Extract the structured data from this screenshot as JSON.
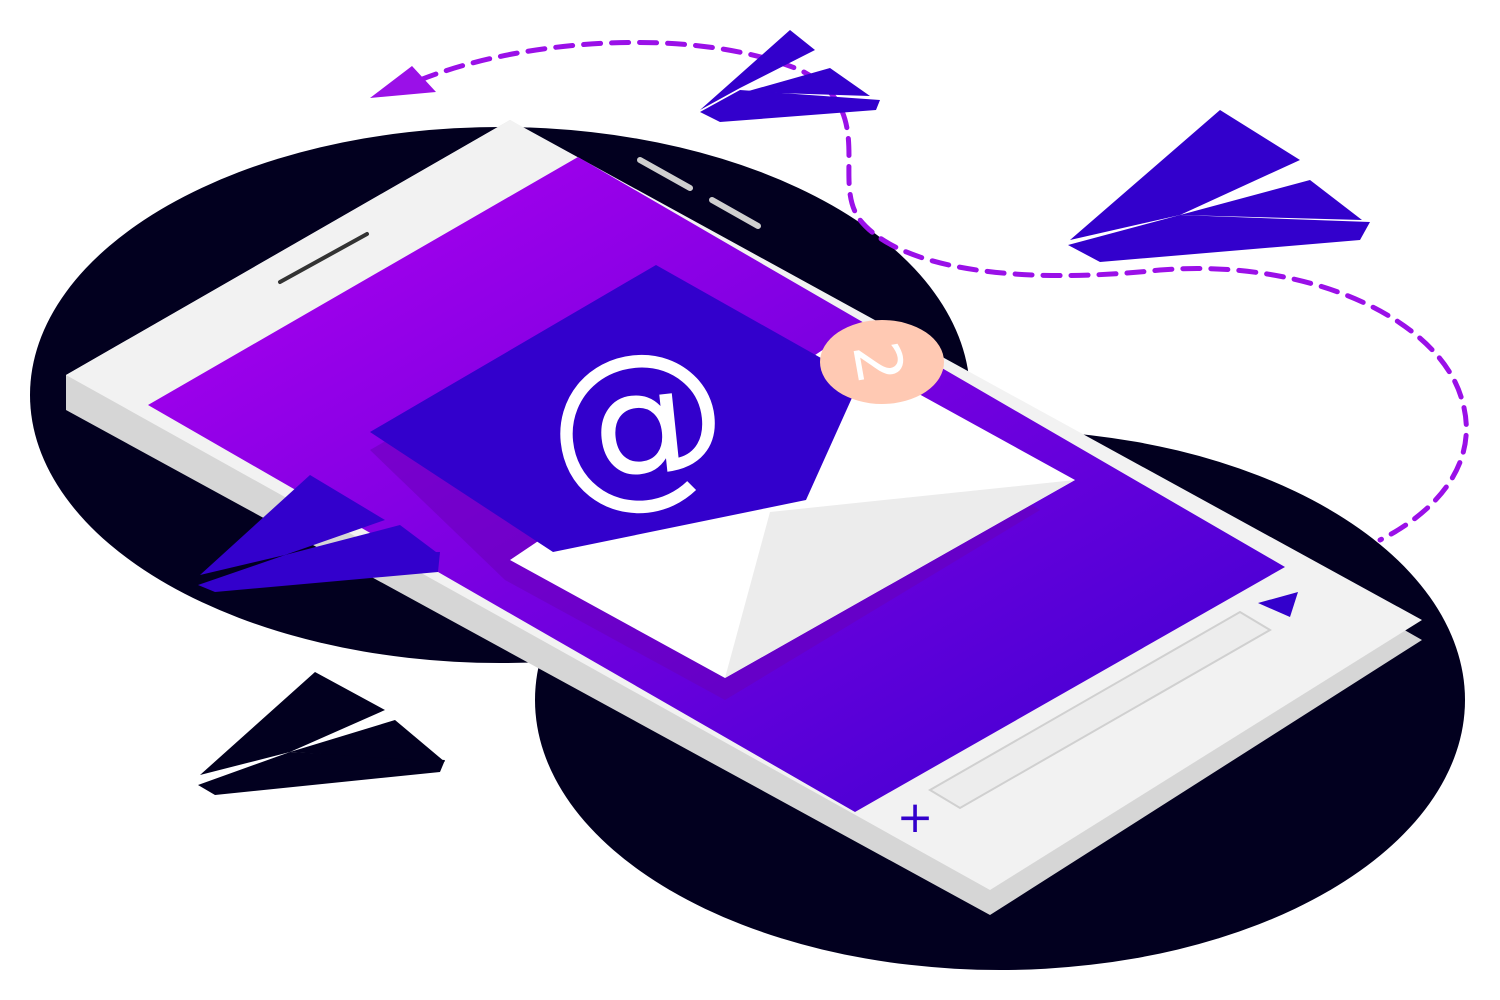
{
  "illustration": {
    "email_symbol": "@",
    "notification_count": "2",
    "add_symbol": "+"
  },
  "icons": {
    "send": "send-arrow-icon",
    "add": "plus-icon",
    "email": "at-sign-icon",
    "paper_plane": "paper-plane-icon"
  },
  "colors": {
    "background": "#ffffff",
    "shadow_blob": "#02001f",
    "phone_body": "#f2f2f2",
    "phone_edge": "#d6d6d6",
    "screen_start": "#b100f0",
    "screen_end": "#3a00d0",
    "envelope_flap": "#3300cc",
    "envelope_body": "#ffffff",
    "badge": "#ffc9b3",
    "paper_plane": "#3300cc",
    "dashed_path": "#9a10e8"
  }
}
